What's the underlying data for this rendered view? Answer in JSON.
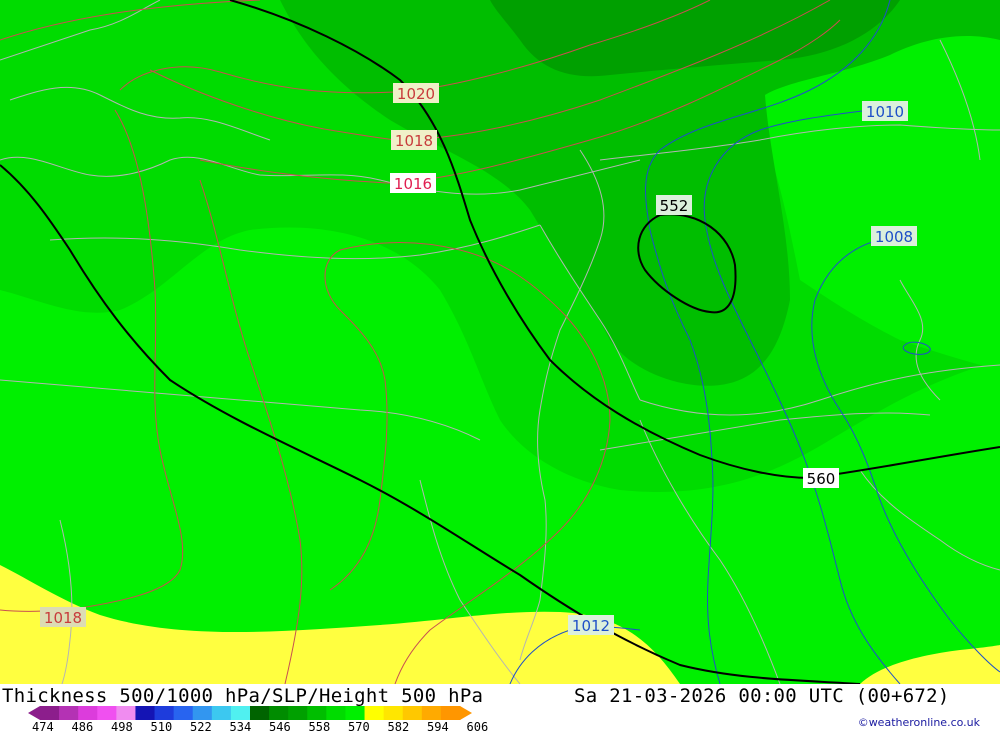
{
  "title": "Thickness 500/1000 hPa/SLP/Height 500 hPa",
  "datetime": "Sa 21-03-2026 00:00 UTC (00+672)",
  "credit": "©weatheronline.co.uk",
  "legend": {
    "ticks": [
      "474",
      "486",
      "498",
      "510",
      "522",
      "534",
      "546",
      "558",
      "570",
      "582",
      "594",
      "606"
    ],
    "colors": [
      "#8c1e8c",
      "#b432b4",
      "#dc3cdc",
      "#f050f0",
      "#f08cf0",
      "#1414b4",
      "#1e3cdc",
      "#2864f0",
      "#3296f0",
      "#3cc8f0",
      "#50f0f0",
      "#006400",
      "#008c00",
      "#00a000",
      "#00be00",
      "#00dc00",
      "#00f000",
      "#ffff00",
      "#ffe600",
      "#ffc800",
      "#ffaa00",
      "#ff9600"
    ]
  },
  "labels": {
    "slp_1020": "1020",
    "slp_1018": "1018",
    "slp_1016": "1016",
    "slp_1018_sw": "1018",
    "slp_1010": "1010",
    "slp_1008": "1008",
    "slp_1012": "1012",
    "height_552": "552",
    "height_560": "560"
  }
}
